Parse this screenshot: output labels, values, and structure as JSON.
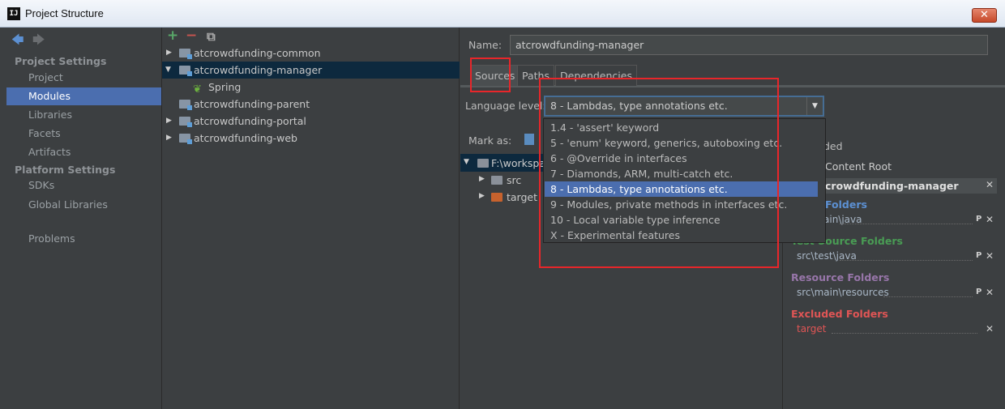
{
  "window": {
    "title": "Project Structure",
    "close_glyph": "✕",
    "app_icon_text": "IJ"
  },
  "sidebar": {
    "nav_back": "🡄",
    "nav_forward": "🡆",
    "project_settings_header": "Project Settings",
    "project_items": [
      "Project",
      "Modules",
      "Libraries",
      "Facets",
      "Artifacts"
    ],
    "platform_settings_header": "Platform Settings",
    "platform_items": [
      "SDKs",
      "Global Libraries"
    ],
    "other_items": [
      "Problems"
    ],
    "selected": "Modules"
  },
  "toolbar": {
    "add": "+",
    "remove": "−",
    "copy": "⧉"
  },
  "modules": [
    {
      "label": "atcrowdfunding-common",
      "expand": "▶"
    },
    {
      "label": "atcrowdfunding-manager",
      "expand": "▼",
      "selected": true
    },
    {
      "label": "Spring",
      "child": true
    },
    {
      "label": "atcrowdfunding-parent",
      "expand": ""
    },
    {
      "label": "atcrowdfunding-portal",
      "expand": "▶"
    },
    {
      "label": "atcrowdfunding-web",
      "expand": "▶"
    }
  ],
  "content": {
    "name_label": "Name:",
    "name_value": "atcrowdfunding-manager",
    "tabs": [
      "Sources",
      "Paths",
      "Dependencies"
    ],
    "active_tab": "Sources",
    "language_level_label": "Language level:",
    "language_level_value": "8 - Lambdas, type annotations etc.",
    "mark_as_label": "Mark as:",
    "root_path": "F:\\workspa",
    "tree_children": [
      "src",
      "target"
    ],
    "excluded_partial": "ded"
  },
  "dropdown_options": [
    "1.4 - 'assert' keyword",
    "5 - 'enum' keyword, generics, autoboxing etc.",
    "6 - @Override in interfaces",
    "7 - Diamonds, ARM, multi-catch etc.",
    "8 - Lambdas, type annotations etc.",
    "9 - Modules, private methods in interfaces etc.",
    "10 - Local variable type inference",
    "X - Experimental features"
  ],
  "selected_option_index": 4,
  "roots_panel": {
    "add_content_root": "Content Root",
    "root_name": "crowdfunding-manager",
    "sections": [
      {
        "title": "Folders",
        "path": "ain\\java",
        "color": "#5c90d2"
      },
      {
        "title": "Test Source Folders",
        "path": "src\\test\\java",
        "color": "#499c54"
      },
      {
        "title": "Resource Folders",
        "path": "src\\main\\resources",
        "color": "#9876aa"
      },
      {
        "title": "Excluded Folders",
        "path": "target",
        "color": "#e05555"
      }
    ],
    "props_glyph": "P",
    "close_glyph": "✕"
  },
  "colors": {
    "selection": "#4b6eaf",
    "annotation_red": "#e8262a",
    "add_green": "#59a869",
    "remove_red": "#c75450"
  }
}
